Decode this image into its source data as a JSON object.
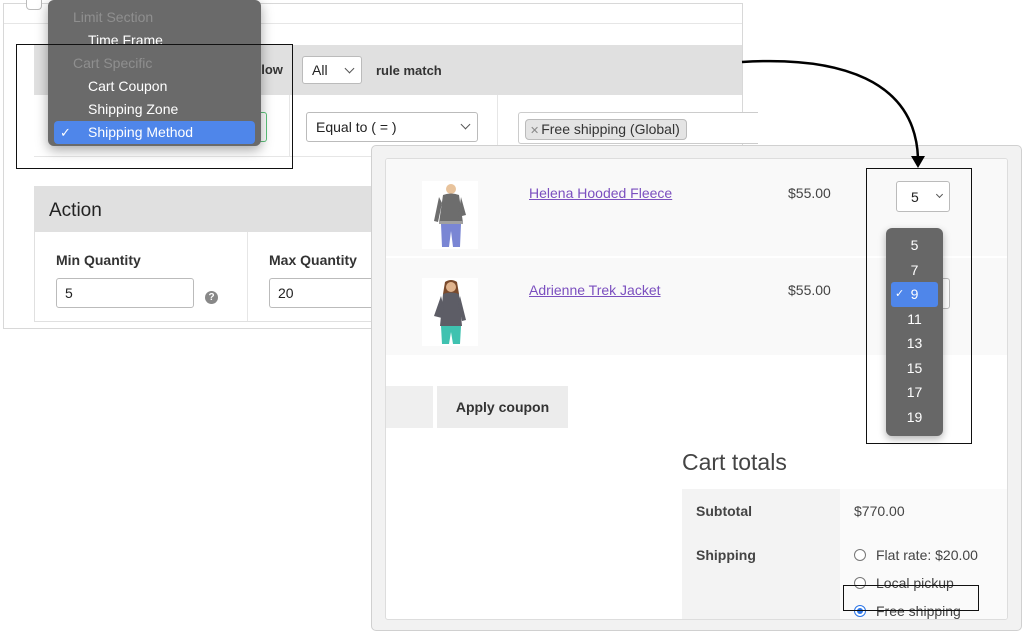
{
  "admin": {
    "conditions": {
      "header_partial_text": "elow",
      "match_select": {
        "value": "All"
      },
      "rule_match_label": "rule match",
      "operator_select": {
        "value": "Equal to ( = )"
      },
      "selected_tags": [
        {
          "label": "Free shipping (Global)"
        }
      ]
    },
    "condition_type_menu": {
      "groups": [
        {
          "label": "Limit Section",
          "items": [
            {
              "label": "Time Frame",
              "selected": false
            }
          ]
        },
        {
          "label": "Cart Specific",
          "items": [
            {
              "label": "Cart Coupon",
              "selected": false
            },
            {
              "label": "Shipping Zone",
              "selected": false
            },
            {
              "label": "Shipping Method",
              "selected": true
            }
          ]
        }
      ],
      "check_glyph": "✓"
    },
    "action": {
      "title": "Action",
      "min_quantity": {
        "label": "Min Quantity",
        "value": "5",
        "help_icon": "question-circle-icon"
      },
      "max_quantity": {
        "label": "Max Quantity",
        "value": "20"
      }
    }
  },
  "cart": {
    "items": [
      {
        "name": "Helena Hooded Fleece",
        "price": "$55.00",
        "quantity": "5",
        "image": "product-image-hoodie"
      },
      {
        "name": "Adrienne Trek Jacket",
        "price": "$55.00",
        "quantity": "9",
        "image": "product-image-jacket"
      }
    ],
    "quantity_options": [
      "5",
      "7",
      "9",
      "11",
      "13",
      "15",
      "17",
      "19"
    ],
    "quantity_selected": "9",
    "apply_coupon_label": "Apply coupon",
    "totals": {
      "title": "Cart totals",
      "subtotal_label": "Subtotal",
      "subtotal_value": "$770.00",
      "shipping_label": "Shipping",
      "shipping_options": [
        {
          "label": "Flat rate: $20.00",
          "selected": false
        },
        {
          "label": "Local pickup",
          "selected": false
        },
        {
          "label": "Free shipping",
          "selected": true
        }
      ]
    }
  },
  "colors": {
    "menu_bg": "#6a6a6a",
    "menu_selected": "#4f86ea",
    "link": "#7b4fbf",
    "radio_selected": "#2a74e6"
  }
}
